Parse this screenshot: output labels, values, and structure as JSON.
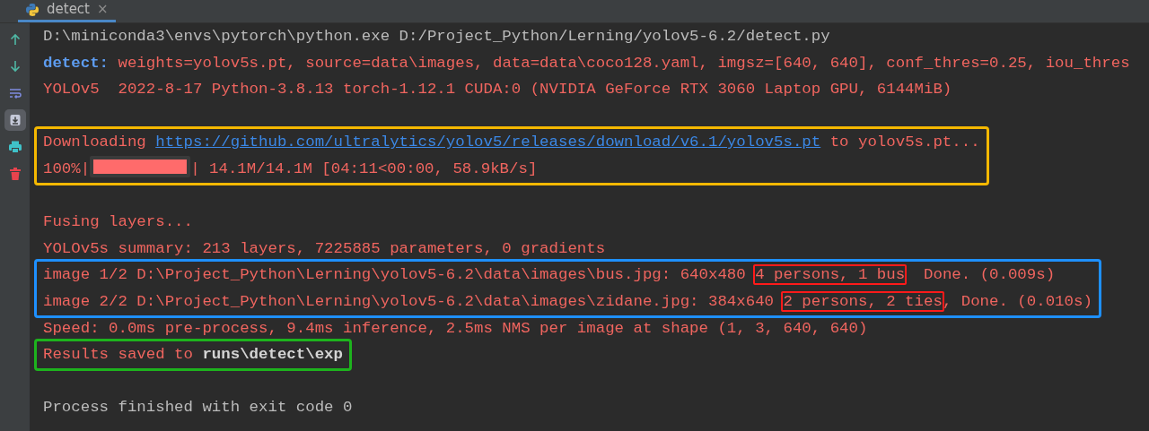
{
  "tab": {
    "title": "detect",
    "close": "×",
    "selected": true
  },
  "toolbar": [
    {
      "kind": "up",
      "selected": false
    },
    {
      "kind": "down",
      "selected": false
    },
    {
      "kind": "wrap",
      "selected": false
    },
    {
      "kind": "scroll-end",
      "selected": true
    },
    {
      "kind": "print",
      "selected": false
    },
    {
      "kind": "trash",
      "selected": false
    }
  ],
  "console": [
    {
      "kind": "lines",
      "lines": [
        {
          "segments": [
            {
              "kind": "stdout",
              "text": "D:\\miniconda3\\envs\\pytorch\\python.exe D:/Project_Python/Lerning/yolov5-6.2/detect.py"
            }
          ]
        },
        {
          "segments": [
            {
              "kind": "label",
              "text": "detect:"
            },
            {
              "kind": "stderr",
              "text": " weights=yolov5s.pt, source=data\\images, data=data\\coco128.yaml, imgsz=[640, 640], conf_thres=0.25, iou_thres"
            }
          ]
        },
        {
          "segments": [
            {
              "kind": "stderr",
              "text": "YOLOv5  2022-8-17 Python-3.8.13 torch-1.12.1 CUDA:0 (NVIDIA GeForce RTX 3060 Laptop GPU, 6144MiB)"
            }
          ]
        }
      ]
    },
    {
      "kind": "blank"
    },
    {
      "kind": "lines",
      "color": "#f5b800",
      "lines": [
        {
          "segments": [
            {
              "kind": "stderr",
              "text": "Downloading "
            },
            {
              "kind": "link",
              "text": "https://github.com/ultralytics/yolov5/releases/download/v6.1/yolov5s.pt"
            },
            {
              "kind": "stderr",
              "text": " to yolov5s.pt..."
            }
          ]
        },
        {
          "segments": [
            {
              "kind": "stderr",
              "text": "100%|"
            },
            {
              "kind": "bar",
              "level": 1
            },
            {
              "kind": "stderr",
              "text": "| 14.1M/14.1M [04:11<00:00, 58.9kB/s]"
            }
          ]
        }
      ]
    },
    {
      "kind": "blank"
    },
    {
      "kind": "lines",
      "lines": [
        {
          "segments": [
            {
              "kind": "stderr",
              "text": "Fusing layers..."
            }
          ]
        },
        {
          "segments": [
            {
              "kind": "stderr",
              "text": "YOLOv5s summary: 213 layers, 7225885 parameters, 0 gradients"
            }
          ]
        }
      ]
    },
    {
      "kind": "lines",
      "color": "#1e90ff",
      "lines": [
        {
          "segments": [
            {
              "kind": "stderr",
              "text": "image 1/2 D:\\Project_Python\\Lerning\\yolov5-6.2\\data\\images\\bus.jpg: 640x480 "
            },
            {
              "kind": "stderr",
              "text": "4 persons, 1 bus",
              "color": "#ff1a1a"
            },
            {
              "kind": "stderr",
              "text": "  Done. (0.009s)"
            }
          ]
        },
        {
          "segments": [
            {
              "kind": "stderr",
              "text": "image 2/2 D:\\Project_Python\\Lerning\\yolov5-6.2\\data\\images\\zidane.jpg: 384x640 "
            },
            {
              "kind": "stderr",
              "text": "2 persons, 2 ties",
              "color": "#ff1a1a"
            },
            {
              "kind": "stderr",
              "text": ", Done. (0.010s)"
            }
          ]
        }
      ]
    },
    {
      "kind": "lines",
      "lines": [
        {
          "segments": [
            {
              "kind": "stderr",
              "text": "Speed: 0.0ms pre-process, 9.4ms inference, 2.5ms NMS per image at shape (1, 3, 640, 640)"
            }
          ]
        }
      ]
    },
    {
      "kind": "lines",
      "color": "#1db31d",
      "lines": [
        {
          "segments": [
            {
              "kind": "stderr",
              "text": "Results saved to "
            },
            {
              "kind": "bold",
              "text": "runs\\detect\\exp"
            }
          ]
        }
      ]
    },
    {
      "kind": "blank"
    },
    {
      "kind": "lines",
      "lines": [
        {
          "segments": [
            {
              "kind": "stdout",
              "text": "Process finished with exit code 0"
            }
          ]
        }
      ]
    }
  ]
}
